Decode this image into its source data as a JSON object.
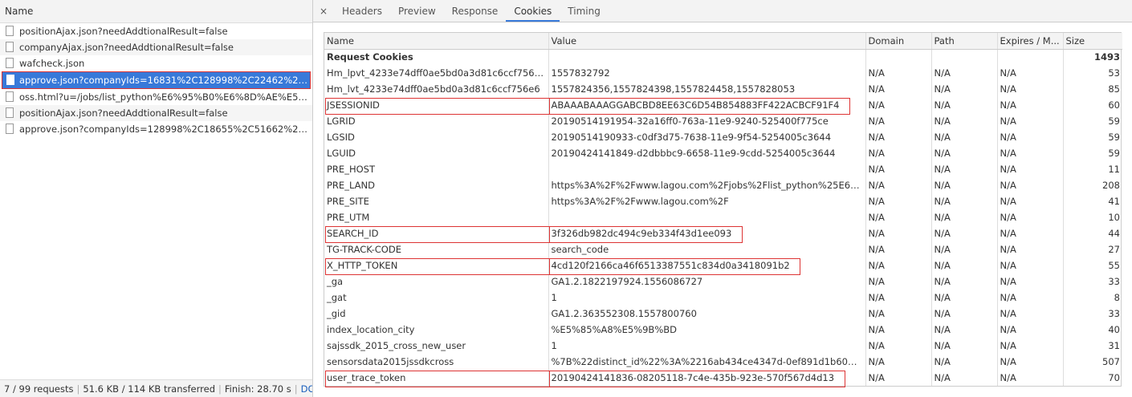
{
  "network": {
    "name_header": "Name",
    "requests": [
      {
        "name": "positionAjax.json?needAddtionalResult=false",
        "selected": false
      },
      {
        "name": "companyAjax.json?needAddtionalResult=false",
        "selected": false
      },
      {
        "name": "wafcheck.json",
        "selected": false
      },
      {
        "name": "approve.json?companyIds=16831%2C128998%2C22462%2C2...2C...",
        "selected": true
      },
      {
        "name": "oss.html?u=/jobs/list_python%E6%95%B0%E6%8D%AE%E5%...l=6...",
        "selected": false
      },
      {
        "name": "positionAjax.json?needAddtionalResult=false",
        "selected": false
      },
      {
        "name": "approve.json?companyIds=128998%2C18655%2C51662%2C1...44...",
        "selected": false
      }
    ],
    "footer": {
      "requests": "7 / 99 requests",
      "transferred": "51.6 KB / 114 KB transferred",
      "finish": "Finish: 28.70 s",
      "dom": "DOM..."
    }
  },
  "detail": {
    "close_glyph": "×",
    "tabs": [
      "Headers",
      "Preview",
      "Response",
      "Cookies",
      "Timing"
    ],
    "active_tab": "Cookies",
    "columns": [
      "Name",
      "Value",
      "Domain",
      "Path",
      "Expires / M...",
      "Size"
    ],
    "group_label": "Request Cookies",
    "group_size": "1493",
    "cookies": [
      {
        "name": "Hm_lpvt_4233e74dff0ae5bd0a3d81c6ccf756e6",
        "value": "1557832792",
        "domain": "N/A",
        "path": "N/A",
        "expires": "N/A",
        "size": "53",
        "highlight": false
      },
      {
        "name": "Hm_lvt_4233e74dff0ae5bd0a3d81c6ccf756e6",
        "value": "1557824356,1557824398,1557824458,1557828053",
        "domain": "N/A",
        "path": "N/A",
        "expires": "N/A",
        "size": "85",
        "highlight": false
      },
      {
        "name": "JSESSIONID",
        "value": "ABAAABAAAGGABCBD8EE63C6D54B854883FF422ACBCF91F4",
        "domain": "N/A",
        "path": "N/A",
        "expires": "N/A",
        "size": "60",
        "highlight": true
      },
      {
        "name": "LGRID",
        "value": "20190514191954-32a16ff0-763a-11e9-9240-525400f775ce",
        "domain": "N/A",
        "path": "N/A",
        "expires": "N/A",
        "size": "59",
        "highlight": false
      },
      {
        "name": "LGSID",
        "value": "20190514190933-c0df3d75-7638-11e9-9f54-5254005c3644",
        "domain": "N/A",
        "path": "N/A",
        "expires": "N/A",
        "size": "59",
        "highlight": false
      },
      {
        "name": "LGUID",
        "value": "20190424141849-d2dbbbc9-6658-11e9-9cdd-5254005c3644",
        "domain": "N/A",
        "path": "N/A",
        "expires": "N/A",
        "size": "59",
        "highlight": false
      },
      {
        "name": "PRE_HOST",
        "value": "",
        "domain": "N/A",
        "path": "N/A",
        "expires": "N/A",
        "size": "11",
        "highlight": false
      },
      {
        "name": "PRE_LAND",
        "value": "https%3A%2F%2Fwww.lagou.com%2Fjobs%2Flist_python%25E6%2595...",
        "domain": "N/A",
        "path": "N/A",
        "expires": "N/A",
        "size": "208",
        "highlight": false
      },
      {
        "name": "PRE_SITE",
        "value": "https%3A%2F%2Fwww.lagou.com%2F",
        "domain": "N/A",
        "path": "N/A",
        "expires": "N/A",
        "size": "41",
        "highlight": false
      },
      {
        "name": "PRE_UTM",
        "value": "",
        "domain": "N/A",
        "path": "N/A",
        "expires": "N/A",
        "size": "10",
        "highlight": false
      },
      {
        "name": "SEARCH_ID",
        "value": "3f326db982dc494c9eb334f43d1ee093",
        "domain": "N/A",
        "path": "N/A",
        "expires": "N/A",
        "size": "44",
        "highlight": true
      },
      {
        "name": "TG-TRACK-CODE",
        "value": "search_code",
        "domain": "N/A",
        "path": "N/A",
        "expires": "N/A",
        "size": "27",
        "highlight": false
      },
      {
        "name": "X_HTTP_TOKEN",
        "value": "4cd120f2166ca46f6513387551c834d0a3418091b2",
        "domain": "N/A",
        "path": "N/A",
        "expires": "N/A",
        "size": "55",
        "highlight": true
      },
      {
        "name": "_ga",
        "value": "GA1.2.1822197924.1556086727",
        "domain": "N/A",
        "path": "N/A",
        "expires": "N/A",
        "size": "33",
        "highlight": false
      },
      {
        "name": "_gat",
        "value": "1",
        "domain": "N/A",
        "path": "N/A",
        "expires": "N/A",
        "size": "8",
        "highlight": false
      },
      {
        "name": "_gid",
        "value": "GA1.2.363552308.1557800760",
        "domain": "N/A",
        "path": "N/A",
        "expires": "N/A",
        "size": "33",
        "highlight": false
      },
      {
        "name": "index_location_city",
        "value": "%E5%85%A8%E5%9B%BD",
        "domain": "N/A",
        "path": "N/A",
        "expires": "N/A",
        "size": "40",
        "highlight": false
      },
      {
        "name": "sajssdk_2015_cross_new_user",
        "value": "1",
        "domain": "N/A",
        "path": "N/A",
        "expires": "N/A",
        "size": "31",
        "highlight": false
      },
      {
        "name": "sensorsdata2015jssdkcross",
        "value": "%7B%22distinct_id%22%3A%2216ab434ce4347d-0ef891d1b606fd-5b1...",
        "domain": "N/A",
        "path": "N/A",
        "expires": "N/A",
        "size": "507",
        "highlight": false
      },
      {
        "name": "user_trace_token",
        "value": "20190424141836-08205118-7c4e-435b-923e-570f567d4d13",
        "domain": "N/A",
        "path": "N/A",
        "expires": "N/A",
        "size": "70",
        "highlight": true
      }
    ]
  }
}
